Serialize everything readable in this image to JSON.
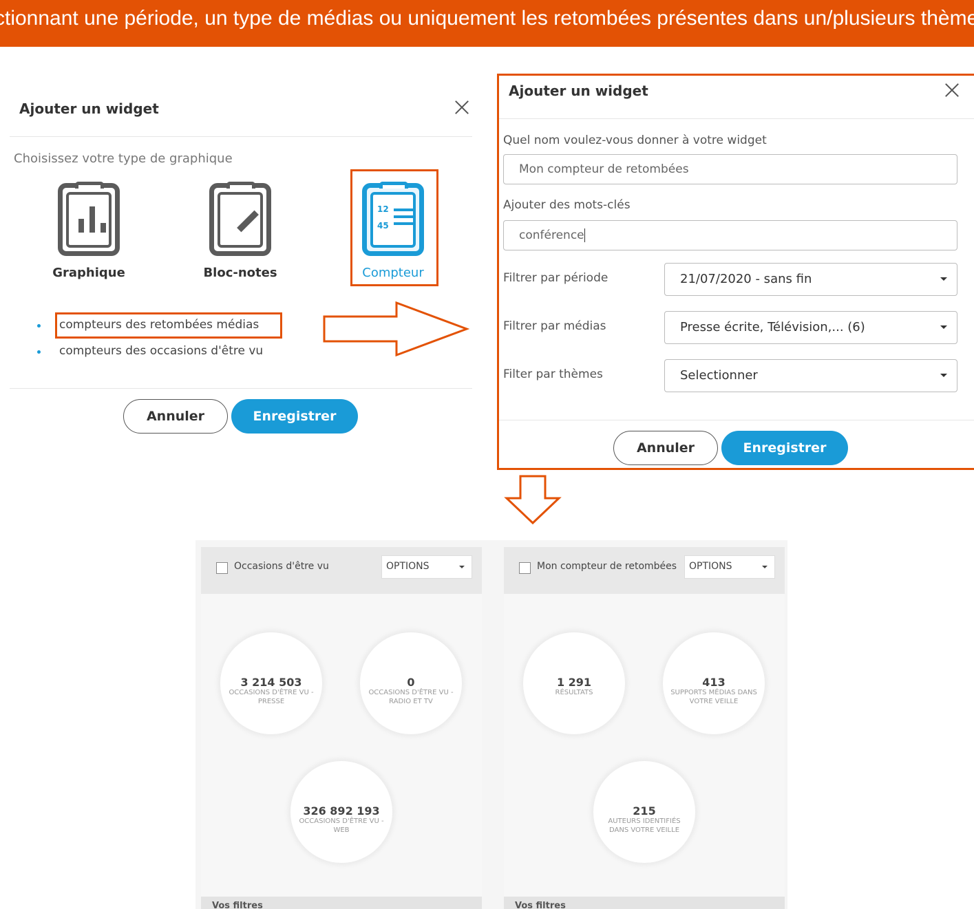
{
  "banner": {
    "text": "ctionnant une période, un type de médias ou uniquement les retombées présentes dans un/plusieurs thèmes"
  },
  "left_dialog": {
    "title": "Ajouter un widget",
    "subtitle": "Choisissez votre type de graphique",
    "types": [
      {
        "label": "Graphique",
        "icon": "bar-chart-clipboard-icon"
      },
      {
        "label": "Bloc-notes",
        "icon": "pencil-clipboard-icon"
      },
      {
        "label": "Compteur",
        "icon": "counter-clipboard-icon",
        "num_top": "12",
        "num_bottom": "45"
      }
    ],
    "options": [
      "compteurs des retombées médias",
      "compteurs des occasions d'être vu"
    ],
    "cancel_label": "Annuler",
    "save_label": "Enregistrer"
  },
  "right_dialog": {
    "title": "Ajouter un widget",
    "name_label": "Quel nom voulez-vous donner à votre widget",
    "name_value": "Mon compteur de retombées",
    "keywords_label": "Ajouter des mots-clés",
    "keywords_value": "conférence",
    "period_label": "Filtrer par période",
    "period_value": "21/07/2020 - sans fin",
    "media_label": "Filtrer par médias",
    "media_value": "Presse écrite, Télévision,... (6)",
    "themes_label": "Filter par thèmes",
    "themes_value": "Selectionner",
    "cancel_label": "Annuler",
    "save_label": "Enregistrer"
  },
  "widgets": [
    {
      "title": "Occasions d'être vu",
      "options_label": "OPTIONS",
      "counters": [
        {
          "value": "3 214 503",
          "caption": "OCCASIONS D'ÊTRE VU - PRESSE"
        },
        {
          "value": "0",
          "caption": "OCCASIONS D'ÊTRE VU - RADIO ET TV"
        },
        {
          "value": "326 892 193",
          "caption": "OCCASIONS D'ÊTRE VU - WEB"
        }
      ],
      "footer": "Vos filtres"
    },
    {
      "title": "Mon compteur de retombées",
      "options_label": "OPTIONS",
      "counters": [
        {
          "value": "1 291",
          "caption": "RÉSULTATS"
        },
        {
          "value": "413",
          "caption": "SUPPORTS MÉDIAS DANS VOTRE VEILLE"
        },
        {
          "value": "215",
          "caption": "AUTEURS IDENTIFIÉS DANS VOTRE VEILLE"
        }
      ],
      "footer": "Vos filtres"
    }
  ],
  "colors": {
    "accent_orange": "#e35205",
    "primary_blue": "#1a9bd7"
  }
}
